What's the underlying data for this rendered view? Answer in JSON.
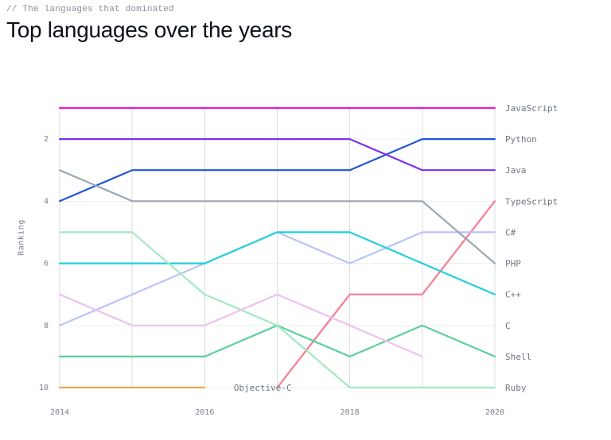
{
  "header": {
    "kicker": "// The languages that dominated",
    "title": "Top languages over the years"
  },
  "chart_data": {
    "type": "line",
    "ylabel": "Ranking",
    "x": [
      2014,
      2015,
      2016,
      2017,
      2018,
      2019,
      2020
    ],
    "xticks": [
      2014,
      2016,
      2018,
      2020
    ],
    "yticks": [
      2,
      4,
      6,
      8,
      10
    ],
    "ylim": [
      10,
      1
    ],
    "series": [
      {
        "name": "JavaScript",
        "color": "#f715d1",
        "values": [
          1,
          1,
          1,
          1,
          1,
          1,
          1
        ]
      },
      {
        "name": "Python",
        "color": "#2156d6",
        "values": [
          4,
          3,
          3,
          3,
          3,
          2,
          2
        ]
      },
      {
        "name": "Java",
        "color": "#7b2ff2",
        "values": [
          2,
          2,
          2,
          2,
          2,
          3,
          3
        ]
      },
      {
        "name": "TypeScript",
        "color": "#f77b8f",
        "values": [
          null,
          null,
          null,
          10,
          7,
          7,
          4
        ]
      },
      {
        "name": "C#",
        "color": "#b9c3f8",
        "values": [
          8,
          7,
          6,
          5,
          6,
          5,
          5
        ]
      },
      {
        "name": "PHP",
        "color": "#9aa6b2",
        "values": [
          3,
          4,
          4,
          4,
          4,
          4,
          6
        ]
      },
      {
        "name": "C++",
        "color": "#21cfdc",
        "values": [
          6,
          6,
          6,
          5,
          5,
          6,
          7
        ]
      },
      {
        "name": "C",
        "color": "#5bcf9a",
        "values": [
          9,
          9,
          9,
          8,
          9,
          8,
          9
        ]
      },
      {
        "name": "Shell",
        "color": "#a2e9c1",
        "values": [
          5,
          5,
          7,
          8,
          10,
          10,
          10
        ]
      },
      {
        "name": "Ruby",
        "color": "#edc0f0",
        "values": [
          7,
          8,
          8,
          7,
          8,
          9,
          null
        ]
      },
      {
        "name": "Objective-C",
        "color": "#efa94a",
        "values": [
          10,
          10,
          10,
          null,
          null,
          null,
          null
        ],
        "inside_label": true,
        "inside_label_x": 2016.4,
        "inside_label_y": 10
      }
    ],
    "legend_entries": [
      "JavaScript",
      "Python",
      "Java",
      "TypeScript",
      "C#",
      "PHP",
      "C++",
      "C",
      "Shell",
      "Ruby"
    ]
  }
}
